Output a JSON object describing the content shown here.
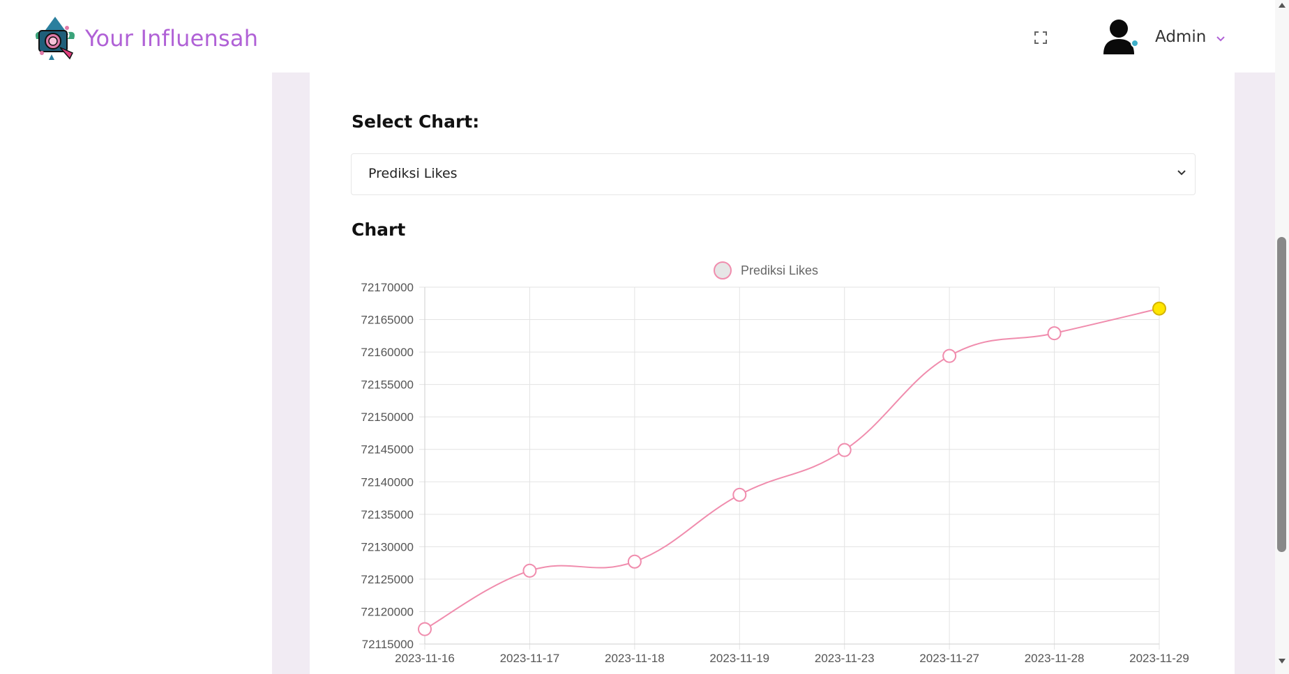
{
  "header": {
    "brand": "Your Influensah",
    "user_name": "Admin"
  },
  "form": {
    "select_label": "Select Chart:",
    "selected_option": "Prediksi Likes"
  },
  "chart_section": {
    "title": "Chart"
  },
  "colors": {
    "brand": "#b061d6",
    "line": "#f08cad",
    "highlight_point": "#ffe600",
    "content_bg": "#f1ebf3"
  },
  "chart_data": {
    "type": "line",
    "title": "",
    "xlabel": "",
    "ylabel": "",
    "legend": "top-center",
    "grid": true,
    "categories": [
      "2023-11-16",
      "2023-11-17",
      "2023-11-18",
      "2023-11-19",
      "2023-11-23",
      "2023-11-27",
      "2023-11-28",
      "2023-11-29"
    ],
    "series": [
      {
        "name": "Prediksi Likes",
        "values": [
          72117300,
          72126300,
          72127700,
          72138000,
          72144900,
          72159400,
          72162900,
          72166700
        ]
      }
    ],
    "ylim": [
      72115000,
      72170000
    ],
    "yticks": [
      72170000,
      72165000,
      72160000,
      72155000,
      72150000,
      72145000,
      72140000,
      72135000,
      72130000,
      72125000,
      72120000,
      72115000
    ],
    "highlighted_index": 7
  }
}
